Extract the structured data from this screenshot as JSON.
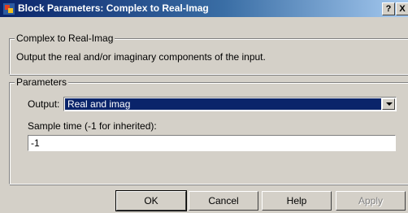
{
  "window": {
    "title": "Block Parameters: Complex to Real-Imag",
    "help_glyph": "?",
    "close_glyph": "X",
    "icon": "simulink-block-icon"
  },
  "description_group": {
    "label": "Complex to Real-Imag",
    "text": "Output the real and/or imaginary components of the input."
  },
  "parameters": {
    "label": "Parameters",
    "output_label": "Output:",
    "output_value": "Real and imag",
    "sample_time_label": "Sample time (-1 for inherited):",
    "sample_time_value": "-1"
  },
  "buttons": {
    "ok": "OK",
    "cancel": "Cancel",
    "help": "Help",
    "apply": "Apply"
  }
}
